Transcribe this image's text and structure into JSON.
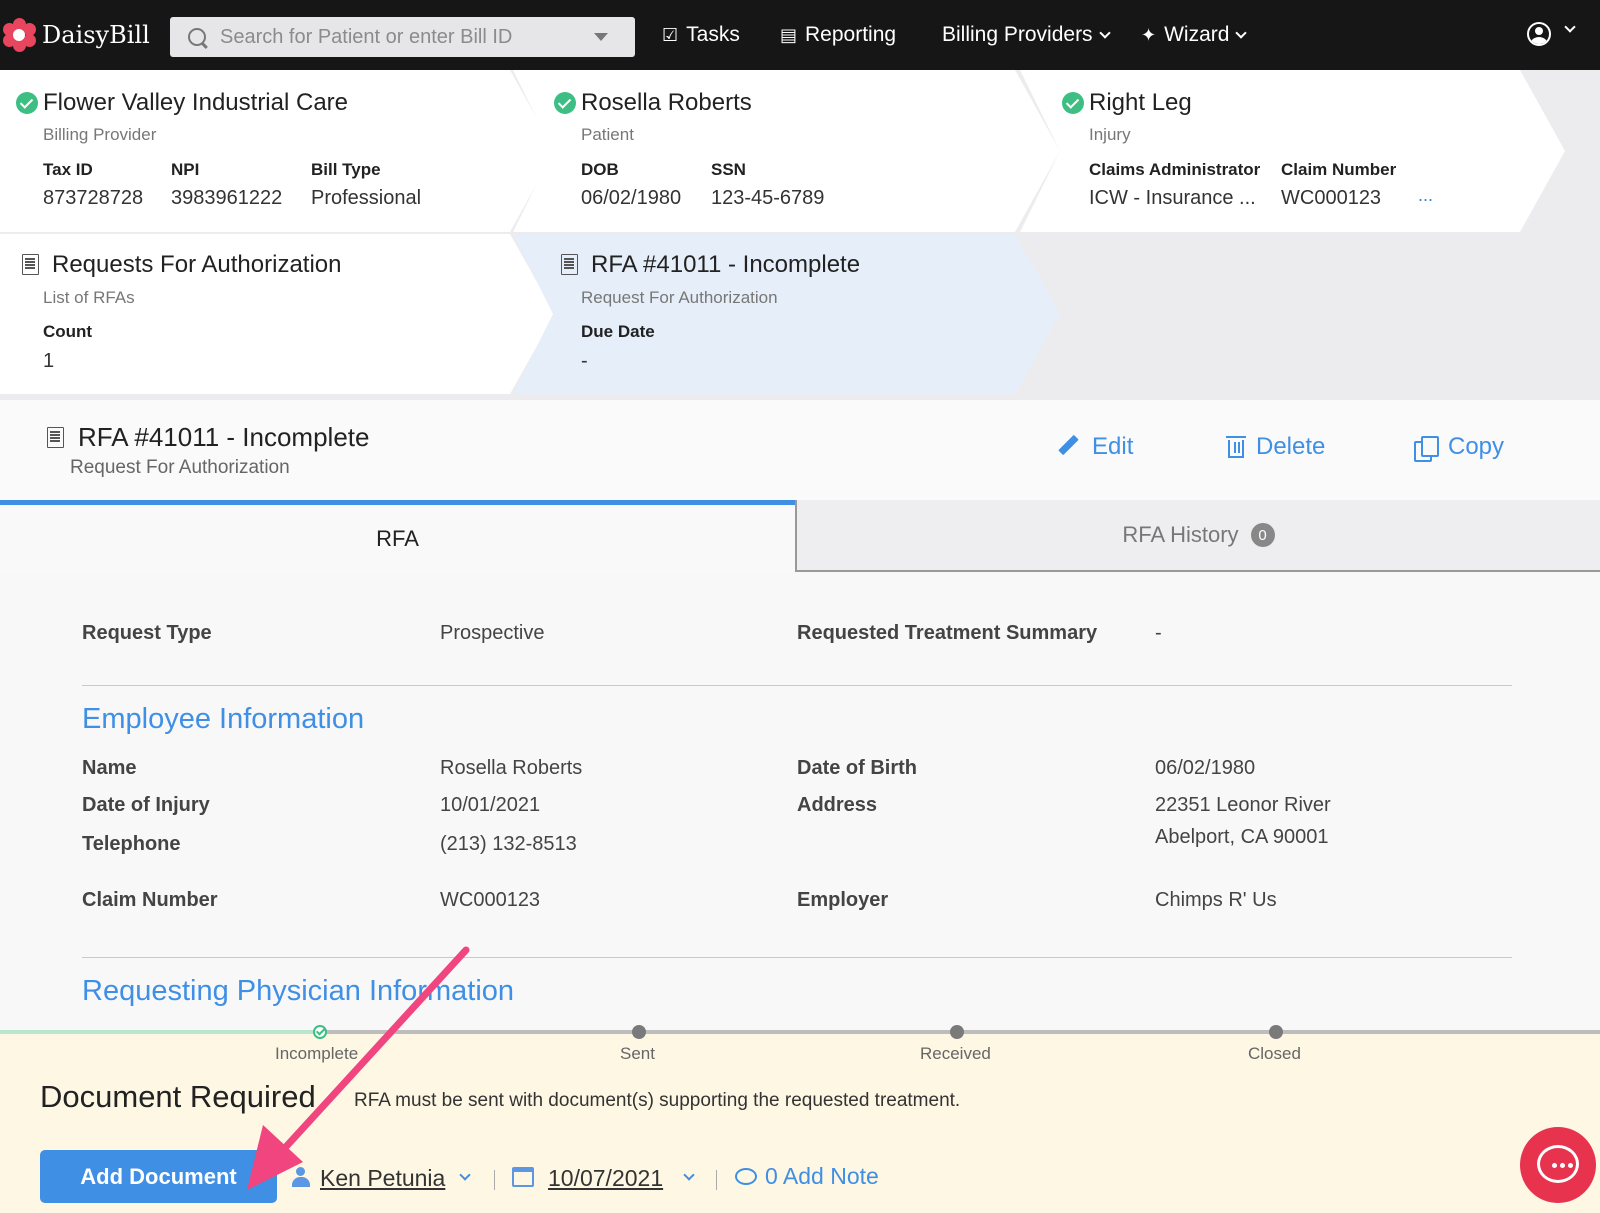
{
  "nav": {
    "brand": "DaisyBill",
    "search_placeholder": "Search for Patient or enter Bill ID",
    "tasks": "Tasks",
    "reporting": "Reporting",
    "billing_providers": "Billing Providers",
    "wizard": "Wizard"
  },
  "provider": {
    "name": "Flower Valley Industrial Care",
    "subtitle": "Billing Provider",
    "tax_id_label": "Tax ID",
    "tax_id": "873728728",
    "npi_label": "NPI",
    "npi": "3983961222",
    "bill_type_label": "Bill Type",
    "bill_type": "Professional"
  },
  "patient": {
    "name": "Rosella Roberts",
    "subtitle": "Patient",
    "dob_label": "DOB",
    "dob": "06/02/1980",
    "ssn_label": "SSN",
    "ssn": "123-45-6789"
  },
  "injury": {
    "name": "Right Leg",
    "subtitle": "Injury",
    "claims_admin_label": "Claims Administrator",
    "claims_admin": "ICW - Insurance ...",
    "claim_number_label": "Claim Number",
    "claim_number": "WC000123",
    "more": "..."
  },
  "rfa_list": {
    "title": "Requests For Authorization",
    "subtitle": "List of RFAs",
    "count_label": "Count",
    "count": "1"
  },
  "rfa_crumb": {
    "title": "RFA #41011 - Incomplete",
    "subtitle": "Request For Authorization",
    "due_label": "Due Date",
    "due": "-"
  },
  "rfa_header": {
    "title": "RFA #41011 - Incomplete",
    "subtitle": "Request For Authorization",
    "edit": "Edit",
    "delete": "Delete",
    "copy": "Copy"
  },
  "tabs": {
    "rfa": "RFA",
    "history": "RFA History",
    "history_count": "0"
  },
  "request": {
    "type_label": "Request Type",
    "type": "Prospective",
    "summary_label": "Requested Treatment Summary",
    "summary": "-"
  },
  "employee": {
    "section": "Employee Information",
    "name_label": "Name",
    "name": "Rosella Roberts",
    "doi_label": "Date of Injury",
    "doi": "10/01/2021",
    "phone_label": "Telephone",
    "phone": "(213) 132-8513",
    "claim_label": "Claim Number",
    "claim": "WC000123",
    "dob_label": "Date of Birth",
    "dob": "06/02/1980",
    "address_label": "Address",
    "address1": "22351 Leonor River",
    "address2": "Abelport, CA 90001",
    "employer_label": "Employer",
    "employer": "Chimps R' Us"
  },
  "physician": {
    "section": "Requesting Physician Information"
  },
  "steps": [
    "Incomplete",
    "Sent",
    "Received",
    "Closed"
  ],
  "status": {
    "title": "Document Required",
    "message": "RFA must be sent with document(s) supporting the requested treatment.",
    "add_button": "Add Document",
    "assignee": "Ken Petunia",
    "date": "10/07/2021",
    "note": "0 Add Note"
  },
  "colors": {
    "accent": "#3f8fe5",
    "success": "#3dbf83",
    "brand": "#e8455e",
    "status_bg": "#fdf7e4",
    "annotation_arrow": "#f0457e"
  }
}
